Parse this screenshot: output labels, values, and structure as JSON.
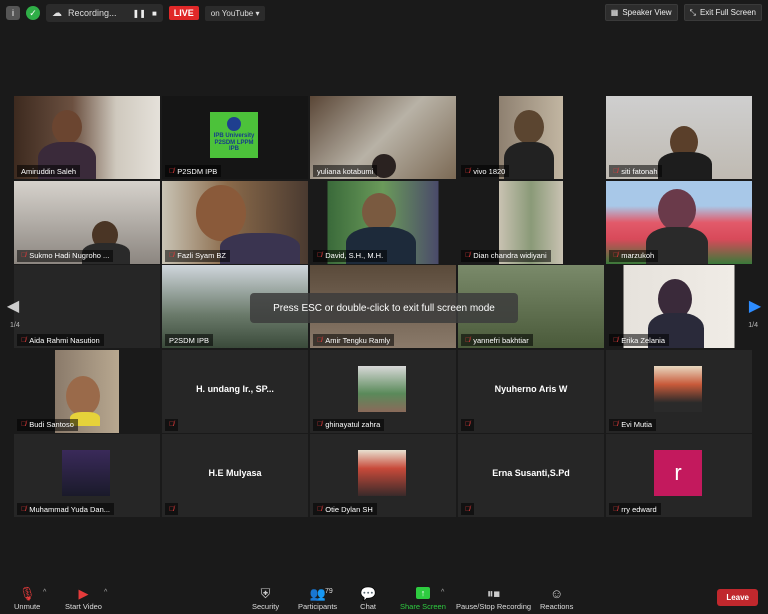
{
  "topbar": {
    "recording_label": "Recording...",
    "recording_pause": "❚❚",
    "recording_stop": "■",
    "live_label": "LIVE",
    "youtube_label": "on YouTube",
    "speaker_view": "Speaker View",
    "exit_fullscreen": "Exit Full Screen"
  },
  "participants": [
    {
      "name": "Amiruddin Saleh",
      "muted": false,
      "active": true
    },
    {
      "name": "P2SDM IPB",
      "muted": true,
      "logo_lines": [
        "IPB University",
        "P2SDM LPPM IPB"
      ]
    },
    {
      "name": "yuliana kotabumi",
      "muted": false
    },
    {
      "name": "vivo 1820",
      "muted": true
    },
    {
      "name": "siti fatonah",
      "muted": true
    },
    {
      "name": "Sukmo Hadi Nugroho ...",
      "muted": true
    },
    {
      "name": "Fazli Syam BZ",
      "muted": true
    },
    {
      "name": "David, S.H., M.H.",
      "muted": true
    },
    {
      "name": "Dian chandra widiyani",
      "muted": true
    },
    {
      "name": "marzukoh",
      "muted": true
    },
    {
      "name": "Aida Rahmi Nasution",
      "muted": true
    },
    {
      "name": "P2SDM IPB",
      "muted": false
    },
    {
      "name": "Amir Tengku Ramly",
      "muted": true
    },
    {
      "name": "yannefri bakhtiar",
      "muted": true
    },
    {
      "name": "Erika Zelania",
      "muted": true
    },
    {
      "name": "Budi Santoso",
      "muted": true
    },
    {
      "name": "",
      "muted": true,
      "center": "H. undang Ir., SP..."
    },
    {
      "name": "ghinayatul zahra",
      "muted": true
    },
    {
      "name": "",
      "muted": true,
      "center": "Nyuherno Aris W"
    },
    {
      "name": "Evi Mutia",
      "muted": true
    },
    {
      "name": "Muhammad Yuda Dan...",
      "muted": true
    },
    {
      "name": "",
      "muted": true,
      "center": "H.E Mulyasa"
    },
    {
      "name": "Otie Dylan SH",
      "muted": true
    },
    {
      "name": "",
      "muted": true,
      "center": "Erna Susanti,S.Pd"
    },
    {
      "name": "rry edward",
      "muted": true,
      "avatar_letter": "r"
    }
  ],
  "toast": "Press ESC or double-click to exit full screen mode",
  "pager": {
    "left": "1/4",
    "right": "1/4"
  },
  "toolbar": {
    "unmute": "Unmute",
    "start_video": "Start Video",
    "security": "Security",
    "participants": "Participants",
    "participants_count": "79",
    "chat": "Chat",
    "share_screen": "Share Screen",
    "pause_stop_recording": "Pause/Stop Recording",
    "reactions": "Reactions",
    "leave": "Leave"
  },
  "colors": {
    "active_border": "#dfe35a",
    "live": "#e02828",
    "share": "#2ecc40",
    "leave": "#c0282d",
    "nav_arrow": "#2d8cff"
  }
}
